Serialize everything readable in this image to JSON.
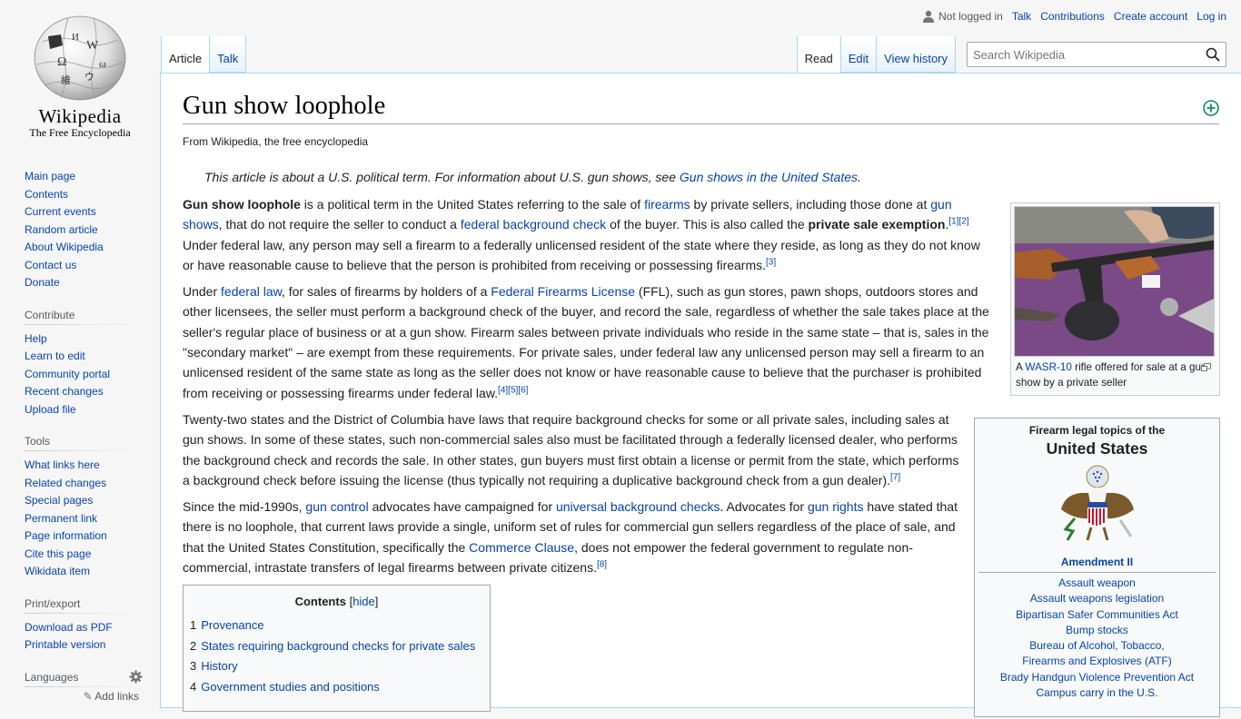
{
  "logo": {
    "wordmark": "Wikipedia",
    "tagline": "The Free Encyclopedia"
  },
  "personal": {
    "not_logged_in": "Not logged in",
    "talk": "Talk",
    "contributions": "Contributions",
    "create_account": "Create account",
    "log_in": "Log in"
  },
  "tabs": {
    "article": "Article",
    "talk": "Talk",
    "read": "Read",
    "edit": "Edit",
    "view_history": "View history"
  },
  "search": {
    "placeholder": "Search Wikipedia",
    "value": ""
  },
  "sidebar": {
    "navigation": [
      "Main page",
      "Contents",
      "Current events",
      "Random article",
      "About Wikipedia",
      "Contact us",
      "Donate"
    ],
    "contribute": {
      "heading": "Contribute",
      "items": [
        "Help",
        "Learn to edit",
        "Community portal",
        "Recent changes",
        "Upload file"
      ]
    },
    "tools": {
      "heading": "Tools",
      "items": [
        "What links here",
        "Related changes",
        "Special pages",
        "Permanent link",
        "Page information",
        "Cite this page",
        "Wikidata item"
      ]
    },
    "print": {
      "heading": "Print/export",
      "items": [
        "Download as PDF",
        "Printable version"
      ]
    },
    "languages": {
      "heading": "Languages",
      "add_links": "Add links"
    }
  },
  "article": {
    "title": "Gun show loophole",
    "site_sub": "From Wikipedia, the free encyclopedia",
    "hatnote_text": "This article is about a U.S. political term. For information about U.S. gun shows, see ",
    "hatnote_link": "Gun shows in the United States",
    "hatnote_end": "."
  },
  "thumb": {
    "caption_a": "A ",
    "caption_link": "WASR-10",
    "caption_rest": " rifle offered for sale at a gun show by a private seller"
  },
  "navbox": {
    "subtitle": "Firearm legal topics of the",
    "title": "United States",
    "amendment": "Amendment II",
    "items": [
      "Assault weapon",
      "Assault weapons legislation",
      "Bipartisan Safer Communities Act",
      "Bump stocks",
      "Bureau of Alcohol, Tobacco,",
      "Firearms and Explosives (ATF)",
      "Brady Handgun Violence Prevention Act",
      "Campus carry in the U.S."
    ]
  },
  "toc": {
    "title": "Contents",
    "hide": "hide",
    "items": [
      {
        "num": "1",
        "label": "Provenance"
      },
      {
        "num": "2",
        "label": "States requiring background checks for private sales"
      },
      {
        "num": "3",
        "label": "History"
      },
      {
        "num": "4",
        "label": "Government studies and positions"
      }
    ]
  },
  "colors": {
    "link": "#0645ad",
    "border": "#a7d7f9",
    "text": "#202122"
  }
}
